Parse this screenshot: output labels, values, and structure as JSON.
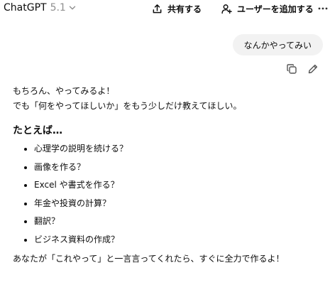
{
  "header": {
    "model_name": "ChatGPT",
    "model_version": "5.1",
    "share_label": "共有する",
    "add_user_label": "ユーザーを追加する"
  },
  "conversation": {
    "user_message": "なんかやってみい",
    "assistant": {
      "intro_lines": [
        "もちろん、やってみるよ！",
        "でも「何をやってほしいか」をもう少しだけ教えてほしい。"
      ],
      "subheading": "たとえば…",
      "examples": [
        "心理学の説明を続ける？",
        "画像を作る？",
        "Excel や書式を作る？",
        "年金や投資の計算？",
        "翻訳？",
        "ビジネス資料の作成？"
      ],
      "closing": "あなたが「これやって」と一言言ってくれたら、すぐに全力で作るよ！"
    }
  },
  "icons": {
    "model_dropdown": "chevron-down-icon",
    "share": "share-icon",
    "add_user": "add-user-icon",
    "more": "more-icon",
    "copy": "copy-icon",
    "edit": "edit-icon"
  }
}
